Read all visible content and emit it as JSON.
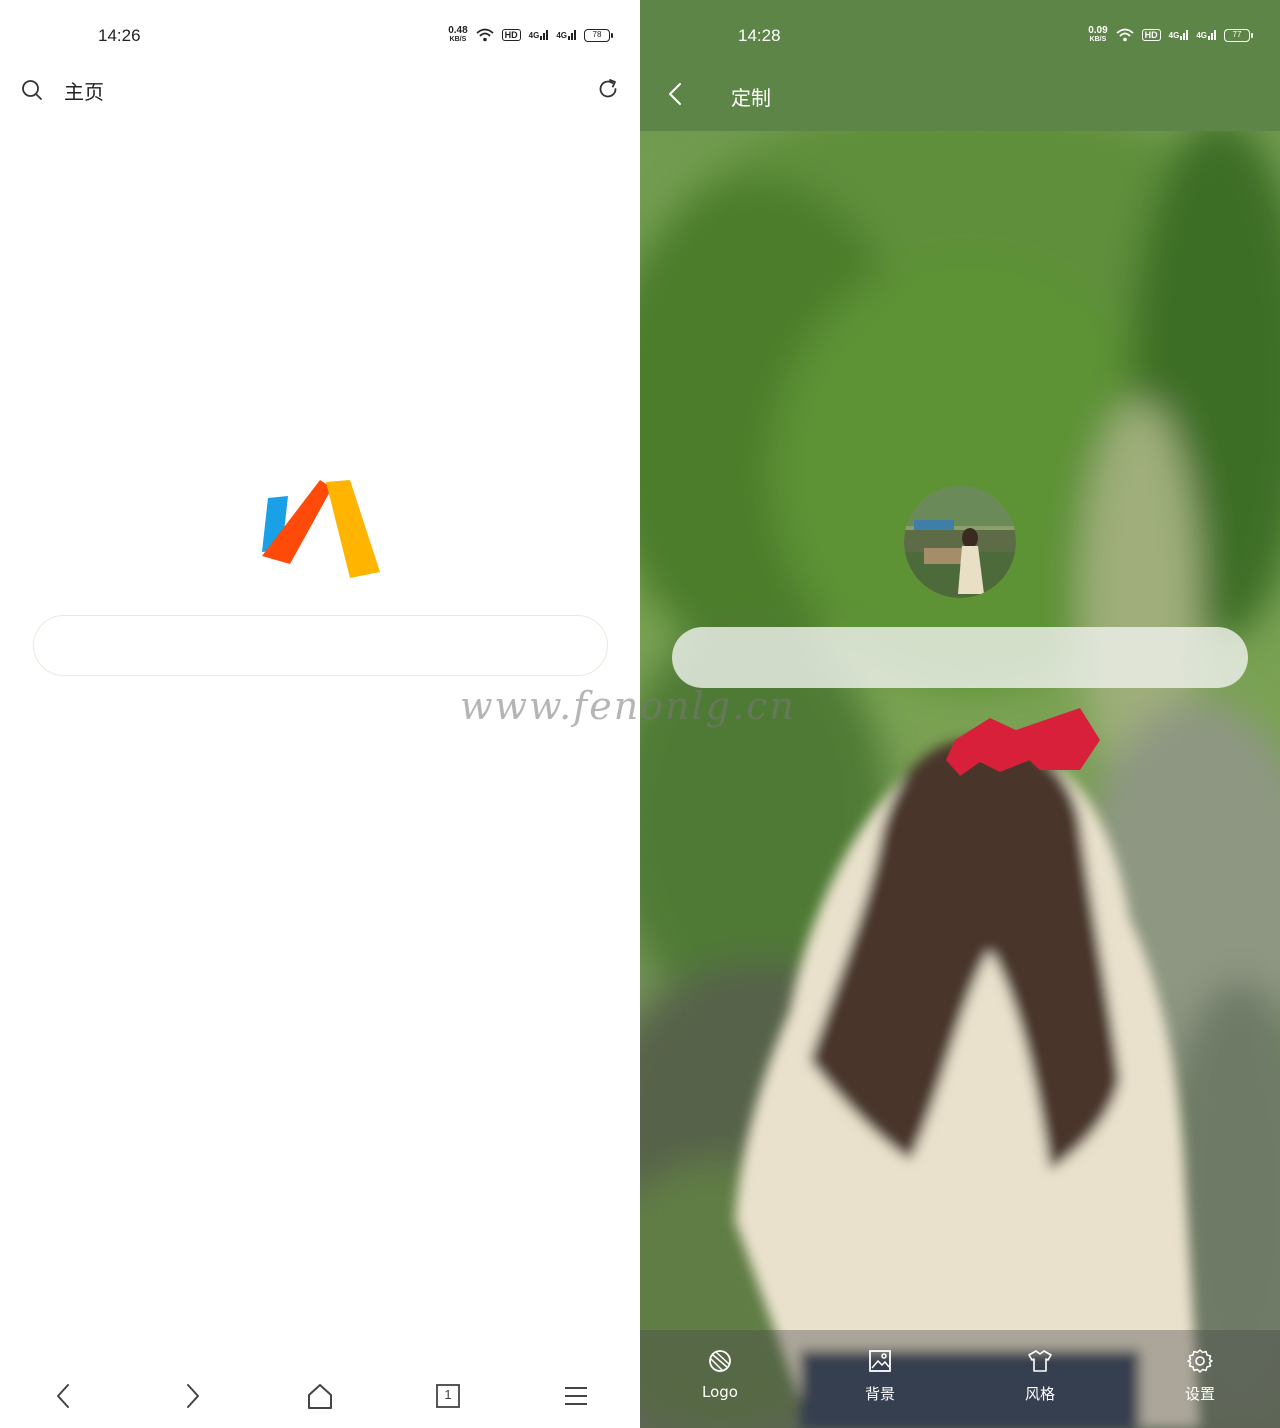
{
  "left": {
    "status": {
      "time": "14:26",
      "net_speed": "0.48",
      "net_unit": "KB/S",
      "hd": "HD",
      "sig1": "4G",
      "sig2": "4G",
      "battery": "78"
    },
    "header": {
      "title": "主页",
      "search_icon": "search-icon",
      "refresh_icon": "refresh-icon"
    },
    "logo": {
      "name": "via-logo",
      "colors": [
        "#1aa0e6",
        "#ff4a0a",
        "#ffb400"
      ]
    },
    "search_box": {
      "placeholder": ""
    },
    "bottom_nav": {
      "items": [
        "back-icon",
        "forward-icon",
        "home-icon",
        "tabs-icon",
        "menu-icon"
      ],
      "tab_count": "1"
    }
  },
  "right": {
    "status": {
      "time": "14:28",
      "net_speed": "0.09",
      "net_unit": "KB/S",
      "hd": "HD",
      "sig1": "4G",
      "sig2": "4G",
      "battery": "77"
    },
    "header": {
      "title": "定制",
      "bg_color": "#5e8548"
    },
    "search_box": {
      "placeholder": ""
    },
    "toolbar": {
      "items": [
        {
          "label": "Logo",
          "icon": "logo-icon"
        },
        {
          "label": "背景",
          "icon": "background-image-icon"
        },
        {
          "label": "风格",
          "icon": "shirt-icon"
        },
        {
          "label": "设置",
          "icon": "gear-icon"
        }
      ]
    }
  },
  "watermark": "www.fenonlg.cn"
}
